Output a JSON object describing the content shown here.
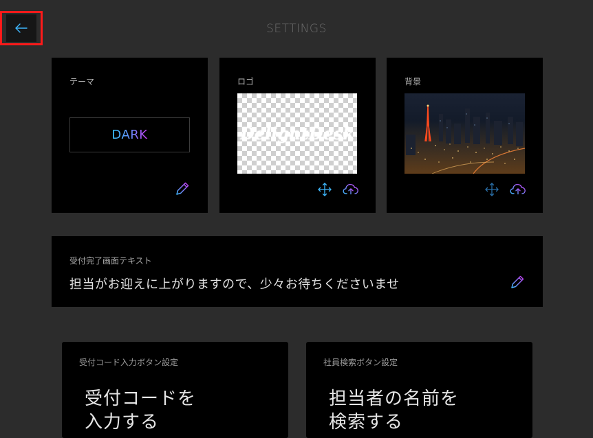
{
  "header": {
    "title": "SETTINGS"
  },
  "theme_card": {
    "label": "テーマ",
    "value": "DARK"
  },
  "logo_card": {
    "label": "ロゴ",
    "logo_text": "DelightDesk"
  },
  "background_card": {
    "label": "背景"
  },
  "completion_text_card": {
    "label": "受付完了画面テキスト",
    "value": "担当がお迎えに上がりますので、少々お待ちくださいませ"
  },
  "code_button_card": {
    "label": "受付コード入力ボタン設定",
    "button_text": "受付コードを\n入力する"
  },
  "search_button_card": {
    "label": "社員検索ボタン設定",
    "button_text": "担当者の名前を\n検索する"
  },
  "icons": {
    "back": "arrow-left-icon",
    "edit": "pencil-icon",
    "move": "move-arrows-icon",
    "upload": "cloud-upload-icon"
  },
  "colors": {
    "background": "#2c2c2c",
    "card": "#000000",
    "accent_blue": "#3fb8ff",
    "accent_purple": "#c838f0",
    "highlight_red": "#ff1a1a"
  }
}
